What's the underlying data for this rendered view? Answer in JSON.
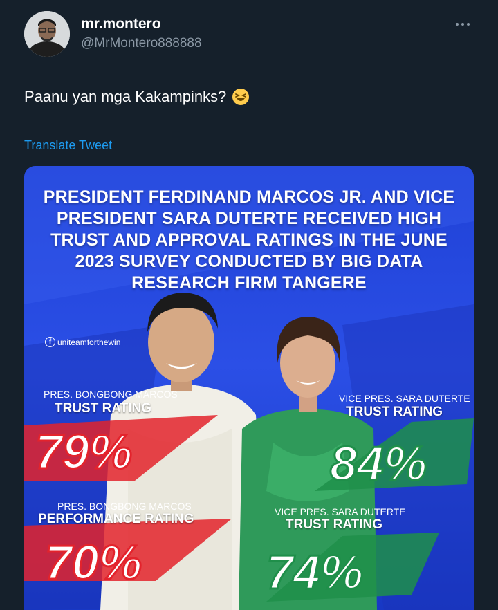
{
  "tweet": {
    "display_name": "mr.montero",
    "handle": "@MrMontero888888",
    "text": "Paanu yan mga Kakampinks?",
    "translate_label": "Translate Tweet"
  },
  "media": {
    "headline": "PRESIDENT FERDINAND MARCOS JR. AND VICE PRESIDENT SARA DUTERTE RECEIVED HIGH TRUST AND APPROVAL RATINGS IN THE JUNE 2023 SURVEY CONDUCTED BY BIG DATA RESEARCH FIRM TANGERE",
    "social_handle": "uniteamforthewin",
    "ratings": [
      {
        "subject": "PRES. BONGBONG MARCOS",
        "label": "TRUST RATING",
        "value": "79%",
        "color": "#e3232c"
      },
      {
        "subject": "VICE PRES. SARA DUTERTE",
        "label": "TRUST RATING",
        "value": "84%",
        "color": "#1f8f4a"
      },
      {
        "subject": "PRES. BONGBONG MARCOS",
        "label": "PERFORMANCE RATING",
        "value": "70%",
        "color": "#e3232c"
      },
      {
        "subject": "VICE PRES. SARA DUTERTE",
        "label": "TRUST RATING",
        "value": "74%",
        "color": "#1f8f4a"
      }
    ]
  },
  "colors": {
    "background": "#15202b",
    "link": "#1d9bf0",
    "media_blue": "#2b4fe6"
  }
}
